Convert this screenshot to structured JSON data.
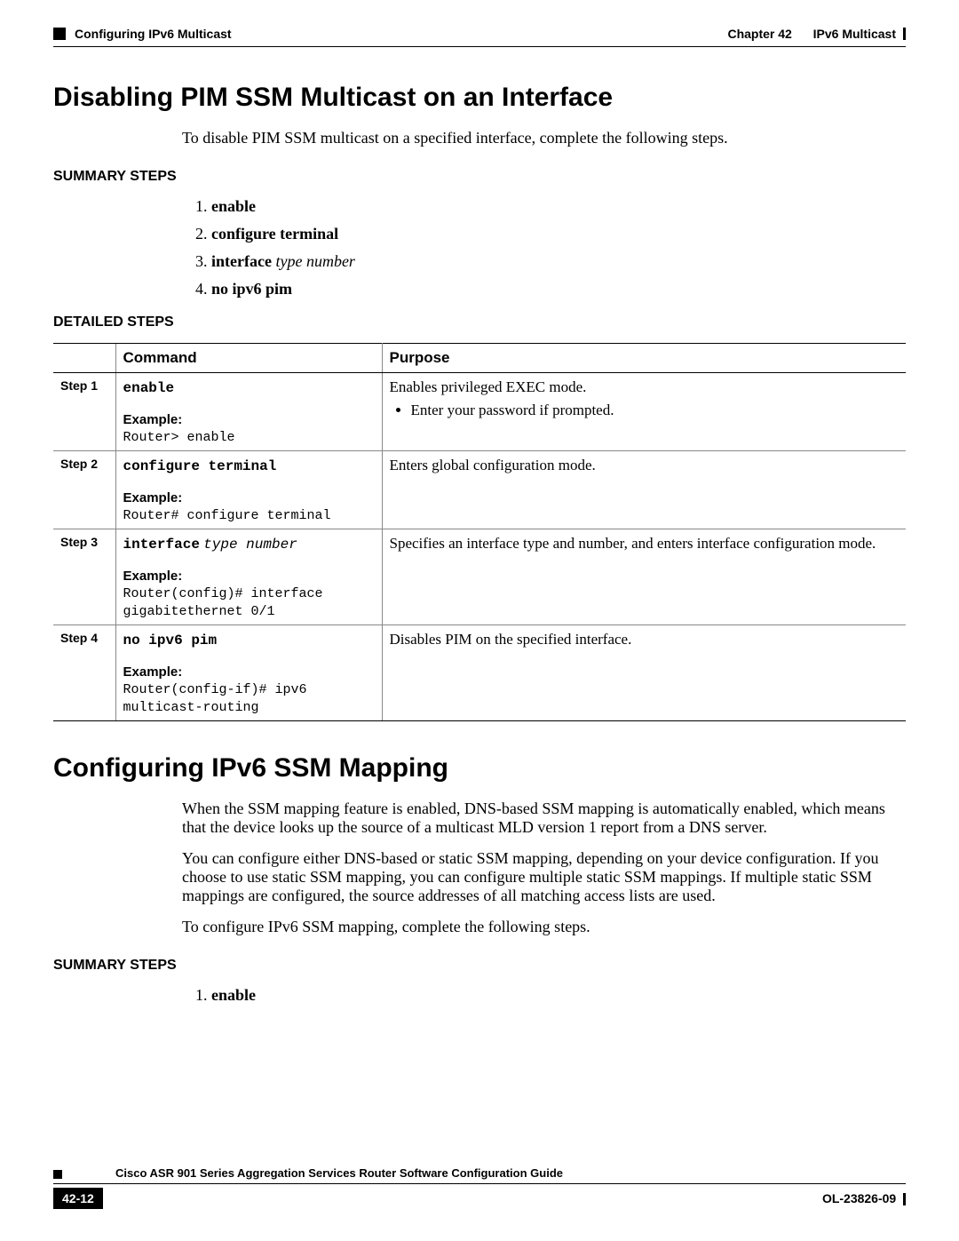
{
  "header": {
    "left_section": "Configuring IPv6 Multicast",
    "chapter_label": "Chapter 42",
    "chapter_title": "IPv6 Multicast"
  },
  "section1": {
    "title": "Disabling PIM SSM Multicast on an Interface",
    "intro": "To disable PIM SSM multicast on a specified interface, complete the following steps.",
    "summary_heading": "SUMMARY STEPS",
    "summary": [
      {
        "cmd": "enable",
        "arg": ""
      },
      {
        "cmd": "configure terminal",
        "arg": ""
      },
      {
        "cmd": "interface",
        "arg": "type number"
      },
      {
        "cmd": "no ipv6 pim",
        "arg": ""
      }
    ],
    "detailed_heading": "DETAILED STEPS",
    "table": {
      "col_step": "",
      "col_cmd": "Command",
      "col_purpose": "Purpose",
      "example_label": "Example:",
      "rows": [
        {
          "step": "Step 1",
          "cmd": "enable",
          "arg": "",
          "example": "Router> enable",
          "purpose": "Enables privileged EXEC mode.",
          "purpose_bullets": [
            "Enter your password if prompted."
          ]
        },
        {
          "step": "Step 2",
          "cmd": "configure terminal",
          "arg": "",
          "example": "Router# configure terminal",
          "purpose": "Enters global configuration mode.",
          "purpose_bullets": []
        },
        {
          "step": "Step 3",
          "cmd": "interface",
          "arg": "type number",
          "example": "Router(config)# interface \ngigabitethernet 0/1",
          "purpose": "Specifies an interface type and number, and enters interface configuration mode.",
          "purpose_bullets": []
        },
        {
          "step": "Step 4",
          "cmd": "no ipv6 pim",
          "arg": "",
          "example": "Router(config-if)# ipv6 \nmulticast-routing",
          "purpose": "Disables PIM on the specified interface.",
          "purpose_bullets": []
        }
      ]
    }
  },
  "section2": {
    "title": "Configuring IPv6 SSM Mapping",
    "p1": "When the SSM mapping feature is enabled, DNS-based SSM mapping is automatically enabled, which means that the device looks up the source of a multicast MLD version 1 report from a DNS server.",
    "p2": "You can configure either DNS-based or static SSM mapping, depending on your device configuration. If you choose to use static SSM mapping, you can configure multiple static SSM mappings. If multiple static SSM mappings are configured, the source addresses of all matching access lists are used.",
    "p3": "To configure IPv6 SSM mapping, complete the following steps.",
    "summary_heading": "SUMMARY STEPS",
    "summary": [
      {
        "cmd": "enable",
        "arg": ""
      }
    ]
  },
  "footer": {
    "guide": "Cisco ASR 901 Series Aggregation Services Router Software Configuration Guide",
    "page": "42-12",
    "doc": "OL-23826-09"
  }
}
